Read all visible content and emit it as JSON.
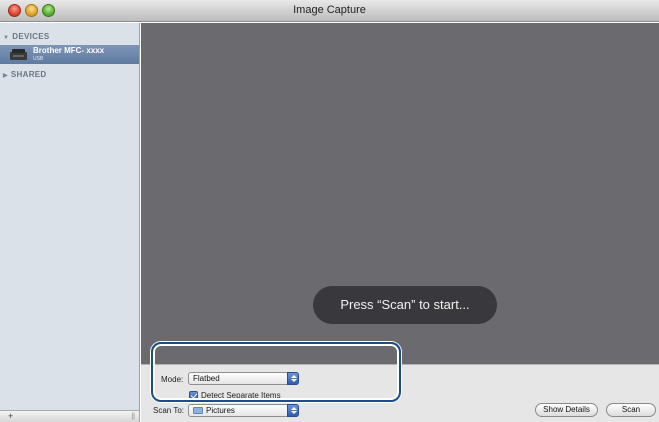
{
  "window": {
    "title": "Image Capture"
  },
  "sidebar": {
    "devices_header": "DEVICES",
    "device": {
      "name": "Brother MFC- xxxx",
      "connection": "USB"
    },
    "shared_header": "SHARED",
    "add_label": "+",
    "resize_label": "||"
  },
  "preview": {
    "message": "Press “Scan” to start..."
  },
  "controls": {
    "mode_label": "Mode:",
    "mode_value": "Flatbed",
    "detect_label": "Detect Separate Items",
    "detect_checked": true,
    "scan_to_label": "Scan To:",
    "scan_to_value": "Pictures",
    "show_details_label": "Show Details",
    "scan_label": "Scan"
  },
  "colors": {
    "highlight": "#1c4f8a",
    "selection": "#6a86ad",
    "preview_bg": "#6a6a6f"
  }
}
